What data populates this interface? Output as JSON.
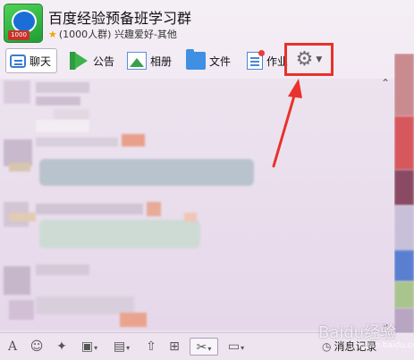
{
  "header": {
    "group_name": "百度经验预备班学习群",
    "member_info": "(1000人群) 兴趣爱好-其他",
    "avatar_badge": "1000",
    "avatar_label": "group-avatar"
  },
  "tabs": [
    {
      "label": "聊天",
      "icon": "chat-icon",
      "active": true
    },
    {
      "label": "公告",
      "icon": "flag-icon",
      "active": false
    },
    {
      "label": "相册",
      "icon": "photo-icon",
      "active": false
    },
    {
      "label": "文件",
      "icon": "folder-icon",
      "active": false
    },
    {
      "label": "作业",
      "icon": "homework-icon",
      "active": false
    }
  ],
  "settings": {
    "icon": "gear-icon",
    "highlight_color": "#e8322b"
  },
  "annotation": {
    "arrow_color": "#e8322b"
  },
  "toolbar": {
    "icons": [
      "font-icon",
      "emoji-icon",
      "magic-icon",
      "gift-icon",
      "image-icon",
      "upload-icon",
      "present-icon",
      "scissors-icon",
      "screen-record-icon"
    ],
    "history_label": "消息记录",
    "history_icon": "clock-icon"
  },
  "watermark": {
    "text": "Baidu经验",
    "subtext": "jingyan.baidu.com"
  },
  "colors": {
    "accent": "#3a7bd5",
    "background": "#ebdfee",
    "highlight": "#e8322b"
  }
}
